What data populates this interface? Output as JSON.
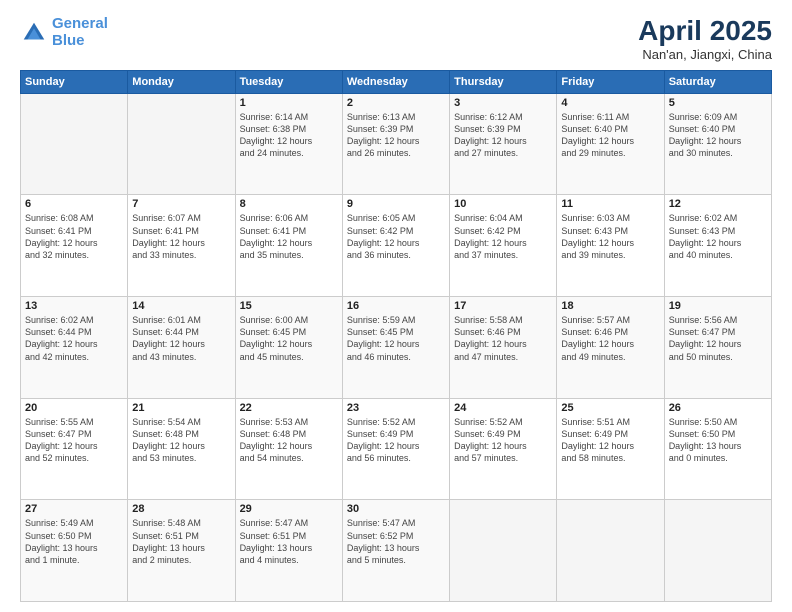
{
  "logo": {
    "line1": "General",
    "line2": "Blue"
  },
  "title": "April 2025",
  "subtitle": "Nan'an, Jiangxi, China",
  "weekdays": [
    "Sunday",
    "Monday",
    "Tuesday",
    "Wednesday",
    "Thursday",
    "Friday",
    "Saturday"
  ],
  "weeks": [
    [
      {
        "day": "",
        "details": ""
      },
      {
        "day": "",
        "details": ""
      },
      {
        "day": "1",
        "details": "Sunrise: 6:14 AM\nSunset: 6:38 PM\nDaylight: 12 hours\nand 24 minutes."
      },
      {
        "day": "2",
        "details": "Sunrise: 6:13 AM\nSunset: 6:39 PM\nDaylight: 12 hours\nand 26 minutes."
      },
      {
        "day": "3",
        "details": "Sunrise: 6:12 AM\nSunset: 6:39 PM\nDaylight: 12 hours\nand 27 minutes."
      },
      {
        "day": "4",
        "details": "Sunrise: 6:11 AM\nSunset: 6:40 PM\nDaylight: 12 hours\nand 29 minutes."
      },
      {
        "day": "5",
        "details": "Sunrise: 6:09 AM\nSunset: 6:40 PM\nDaylight: 12 hours\nand 30 minutes."
      }
    ],
    [
      {
        "day": "6",
        "details": "Sunrise: 6:08 AM\nSunset: 6:41 PM\nDaylight: 12 hours\nand 32 minutes."
      },
      {
        "day": "7",
        "details": "Sunrise: 6:07 AM\nSunset: 6:41 PM\nDaylight: 12 hours\nand 33 minutes."
      },
      {
        "day": "8",
        "details": "Sunrise: 6:06 AM\nSunset: 6:41 PM\nDaylight: 12 hours\nand 35 minutes."
      },
      {
        "day": "9",
        "details": "Sunrise: 6:05 AM\nSunset: 6:42 PM\nDaylight: 12 hours\nand 36 minutes."
      },
      {
        "day": "10",
        "details": "Sunrise: 6:04 AM\nSunset: 6:42 PM\nDaylight: 12 hours\nand 37 minutes."
      },
      {
        "day": "11",
        "details": "Sunrise: 6:03 AM\nSunset: 6:43 PM\nDaylight: 12 hours\nand 39 minutes."
      },
      {
        "day": "12",
        "details": "Sunrise: 6:02 AM\nSunset: 6:43 PM\nDaylight: 12 hours\nand 40 minutes."
      }
    ],
    [
      {
        "day": "13",
        "details": "Sunrise: 6:02 AM\nSunset: 6:44 PM\nDaylight: 12 hours\nand 42 minutes."
      },
      {
        "day": "14",
        "details": "Sunrise: 6:01 AM\nSunset: 6:44 PM\nDaylight: 12 hours\nand 43 minutes."
      },
      {
        "day": "15",
        "details": "Sunrise: 6:00 AM\nSunset: 6:45 PM\nDaylight: 12 hours\nand 45 minutes."
      },
      {
        "day": "16",
        "details": "Sunrise: 5:59 AM\nSunset: 6:45 PM\nDaylight: 12 hours\nand 46 minutes."
      },
      {
        "day": "17",
        "details": "Sunrise: 5:58 AM\nSunset: 6:46 PM\nDaylight: 12 hours\nand 47 minutes."
      },
      {
        "day": "18",
        "details": "Sunrise: 5:57 AM\nSunset: 6:46 PM\nDaylight: 12 hours\nand 49 minutes."
      },
      {
        "day": "19",
        "details": "Sunrise: 5:56 AM\nSunset: 6:47 PM\nDaylight: 12 hours\nand 50 minutes."
      }
    ],
    [
      {
        "day": "20",
        "details": "Sunrise: 5:55 AM\nSunset: 6:47 PM\nDaylight: 12 hours\nand 52 minutes."
      },
      {
        "day": "21",
        "details": "Sunrise: 5:54 AM\nSunset: 6:48 PM\nDaylight: 12 hours\nand 53 minutes."
      },
      {
        "day": "22",
        "details": "Sunrise: 5:53 AM\nSunset: 6:48 PM\nDaylight: 12 hours\nand 54 minutes."
      },
      {
        "day": "23",
        "details": "Sunrise: 5:52 AM\nSunset: 6:49 PM\nDaylight: 12 hours\nand 56 minutes."
      },
      {
        "day": "24",
        "details": "Sunrise: 5:52 AM\nSunset: 6:49 PM\nDaylight: 12 hours\nand 57 minutes."
      },
      {
        "day": "25",
        "details": "Sunrise: 5:51 AM\nSunset: 6:49 PM\nDaylight: 12 hours\nand 58 minutes."
      },
      {
        "day": "26",
        "details": "Sunrise: 5:50 AM\nSunset: 6:50 PM\nDaylight: 13 hours\nand 0 minutes."
      }
    ],
    [
      {
        "day": "27",
        "details": "Sunrise: 5:49 AM\nSunset: 6:50 PM\nDaylight: 13 hours\nand 1 minute."
      },
      {
        "day": "28",
        "details": "Sunrise: 5:48 AM\nSunset: 6:51 PM\nDaylight: 13 hours\nand 2 minutes."
      },
      {
        "day": "29",
        "details": "Sunrise: 5:47 AM\nSunset: 6:51 PM\nDaylight: 13 hours\nand 4 minutes."
      },
      {
        "day": "30",
        "details": "Sunrise: 5:47 AM\nSunset: 6:52 PM\nDaylight: 13 hours\nand 5 minutes."
      },
      {
        "day": "",
        "details": ""
      },
      {
        "day": "",
        "details": ""
      },
      {
        "day": "",
        "details": ""
      }
    ]
  ]
}
